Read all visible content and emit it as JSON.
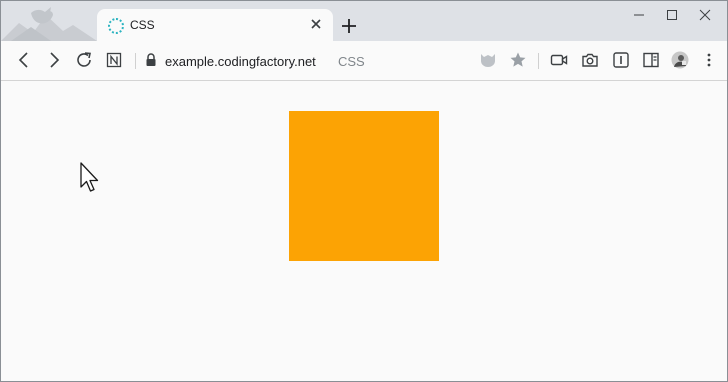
{
  "window": {
    "controls": [
      "minimize-icon",
      "maximize-icon",
      "close-icon"
    ]
  },
  "tab": {
    "title": "CSS",
    "favicon": "loading-spinner-icon",
    "close_icon": "close-icon"
  },
  "toolbar": {
    "nav_icons": [
      "back-icon",
      "forward-icon",
      "reload-icon",
      "notion-icon"
    ],
    "address": {
      "lock_icon": "lock-icon",
      "url": "example.codingfactory.net",
      "page_title": "CSS"
    },
    "right_icons": [
      "shield-icon",
      "star-icon",
      "video-icon",
      "camera-icon",
      "reader-icon",
      "side-panel-icon",
      "avatar",
      "menu-icon"
    ]
  },
  "content": {
    "box_color": "#fca304"
  }
}
